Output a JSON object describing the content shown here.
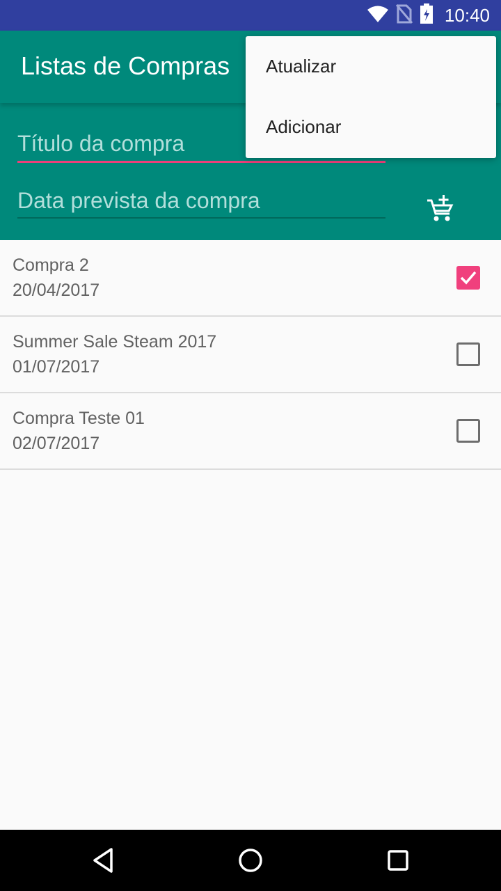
{
  "status_bar": {
    "time": "10:40",
    "icons": [
      "wifi-icon",
      "no-sim-icon",
      "battery-icon"
    ]
  },
  "app_bar": {
    "title": "Listas de Compras"
  },
  "form": {
    "title_placeholder": "Título da compra",
    "date_placeholder": "Data prevista da compra",
    "add_icon": "add-shopping-cart-icon"
  },
  "list": {
    "items": [
      {
        "title": "Compra 2",
        "date": "20/04/2017",
        "checked": true
      },
      {
        "title": "Summer Sale Steam 2017",
        "date": "01/07/2017",
        "checked": false
      },
      {
        "title": "Compra Teste 01",
        "date": "02/07/2017",
        "checked": false
      }
    ]
  },
  "menu": {
    "items": [
      {
        "label": "Atualizar"
      },
      {
        "label": "Adicionar"
      }
    ]
  },
  "nav_bar": {
    "icons": [
      "back-icon",
      "home-icon",
      "recents-icon"
    ]
  },
  "colors": {
    "status_bar": "#303f9f",
    "primary": "#00897b",
    "accent": "#f0407d",
    "background": "#fafafa"
  }
}
